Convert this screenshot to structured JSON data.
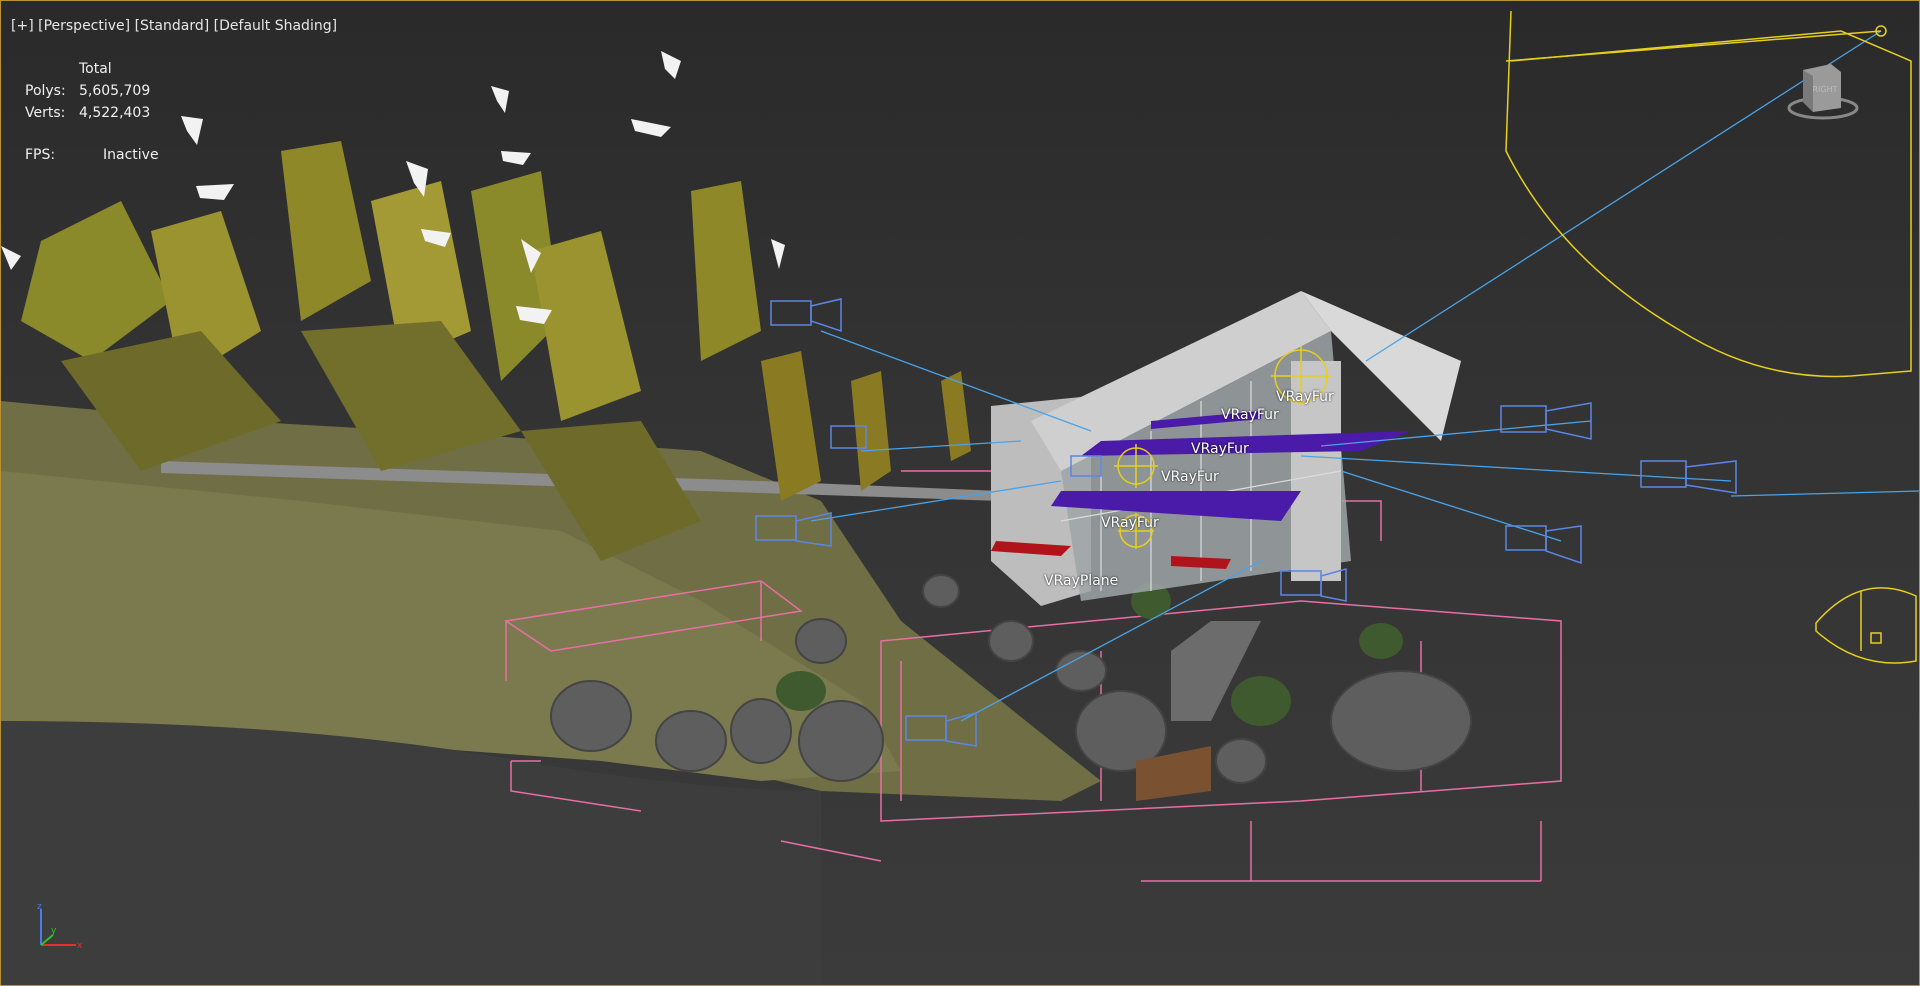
{
  "viewport": {
    "menu_plus": "[+]",
    "view": "[Perspective]",
    "style": "[Standard]",
    "shading": "[Default Shading]"
  },
  "stats": {
    "header": "Total",
    "polys_label": "Polys:",
    "polys_value": "5,605,709",
    "verts_label": "Verts:",
    "verts_value": "4,522,403",
    "fps_label": "FPS:",
    "fps_value": "Inactive"
  },
  "scene_labels": {
    "fur_1": "VRayFur",
    "fur_2": "VRayFur",
    "fur_3": "VRayFur",
    "fur_4": "VRayFur",
    "fur_5": "VRayFur",
    "plane": "VRayPlane"
  },
  "viewcube": {
    "face": "RIGHT"
  },
  "axis": {
    "z": "z",
    "y": "y",
    "x": "x"
  },
  "colors": {
    "frame": "#b9942e",
    "camera": "#5c86e6",
    "camera_line": "#4aa3e8",
    "gizmo": "#e6cf1f",
    "box": "#e86fa3",
    "fur": "#4a1aa8",
    "foliage": "#8a8a2a",
    "ground": "#6f6e45"
  },
  "icons": [
    "camera-icon",
    "light-gizmo-icon",
    "viewcube-icon",
    "axis-tripod-icon"
  ]
}
